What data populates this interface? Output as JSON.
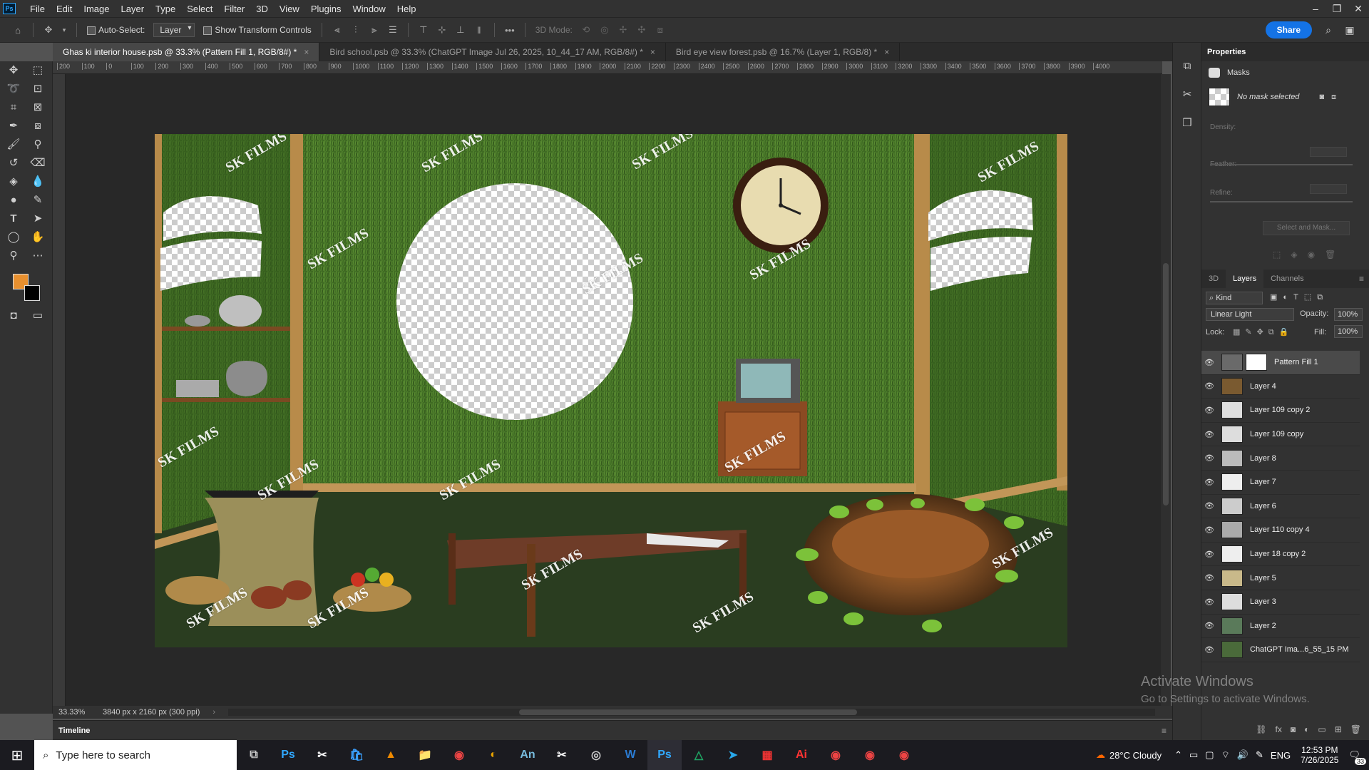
{
  "app": {
    "logo": "Ps"
  },
  "menu": [
    "File",
    "Edit",
    "Image",
    "Layer",
    "Type",
    "Select",
    "Filter",
    "3D",
    "View",
    "Plugins",
    "Window",
    "Help"
  ],
  "options": {
    "auto_select_label": "Auto-Select:",
    "auto_select_value": "Layer",
    "transform_label": "Show Transform Controls",
    "mode_label": "3D Mode:",
    "share_label": "Share"
  },
  "tabs": [
    {
      "label": "Ghas ki interior house.psb @ 33.3% (Pattern Fill 1, RGB/8#) *"
    },
    {
      "label": "Bird school.psb @ 33.3% (ChatGPT Image Jul 26, 2025, 10_44_17 AM, RGB/8#) *"
    },
    {
      "label": "Bird eye view forest.psb @ 16.7% (Layer 1, RGB/8) *"
    }
  ],
  "ruler_ticks": [
    "200",
    "100",
    "0",
    "100",
    "200",
    "300",
    "400",
    "500",
    "600",
    "700",
    "800",
    "900",
    "1000",
    "1100",
    "1200",
    "1300",
    "1400",
    "1500",
    "1600",
    "1700",
    "1800",
    "1900",
    "2000",
    "2100",
    "2200",
    "2300",
    "2400",
    "2500",
    "2600",
    "2700",
    "2800",
    "2900",
    "3000",
    "3100",
    "3200",
    "3300",
    "3400",
    "3500",
    "3600",
    "3700",
    "3800",
    "3900",
    "4000"
  ],
  "canvas": {
    "watermark": "SK FILMS"
  },
  "status": {
    "zoom": "33.33%",
    "doc_info": "3840 px x 2160 px (300 ppi)"
  },
  "timeline_label": "Timeline",
  "properties": {
    "title": "Properties",
    "masks_label": "Masks",
    "no_mask": "No mask selected",
    "density": "Density:",
    "feather": "Feather:",
    "refine": "Refine:",
    "select_mask": "Select and Mask..."
  },
  "layers_panel": {
    "tabs": [
      "3D",
      "Layers",
      "Channels"
    ],
    "kind": "Kind",
    "blend_mode": "Linear Light",
    "opacity_label": "Opacity:",
    "opacity_value": "100%",
    "lock_label": "Lock:",
    "fill_label": "Fill:",
    "fill_value": "100%",
    "layers": [
      {
        "name": "Pattern Fill 1"
      },
      {
        "name": "Layer 4"
      },
      {
        "name": "Layer 109 copy 2"
      },
      {
        "name": "Layer 109 copy"
      },
      {
        "name": "Layer 8"
      },
      {
        "name": "Layer 7"
      },
      {
        "name": "Layer 6"
      },
      {
        "name": "Layer 110 copy 4"
      },
      {
        "name": "Layer 18 copy 2"
      },
      {
        "name": "Layer 5"
      },
      {
        "name": "Layer 3"
      },
      {
        "name": "Layer 2"
      },
      {
        "name": "ChatGPT Ima...6_55_15 PM"
      }
    ]
  },
  "activate": {
    "line1": "Activate Windows",
    "line2": "Go to Settings to activate Windows."
  },
  "taskbar": {
    "search_placeholder": "Type here to search",
    "weather": "28°C  Cloudy",
    "lang": "ENG",
    "time": "12:53 PM",
    "date": "7/26/2025",
    "notif_count": "33"
  },
  "colors": {
    "foreground": "#e8902f",
    "background": "#000000",
    "accent": "#1473e6"
  }
}
